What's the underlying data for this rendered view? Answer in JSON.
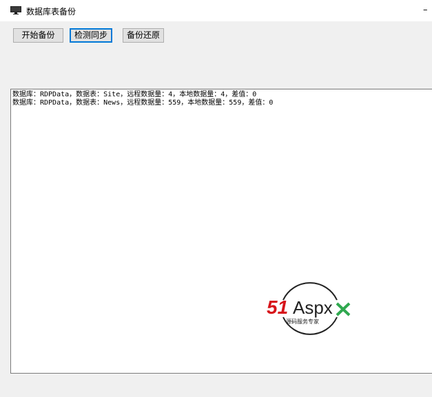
{
  "window": {
    "title": "数据库表备份",
    "minimize_glyph": "–"
  },
  "toolbar": {
    "start_backup": "开始备份",
    "check_sync": "检测同步",
    "restore_backup": "备份还原"
  },
  "log": {
    "lines": [
      "数据库：RDPData，数据表：Site，远程数据量：4，本地数据量：4，差值：0",
      "数据库：RDPData，数据表：News，远程数据量：559，本地数据量：559，差值：0"
    ]
  },
  "watermark": {
    "brand_51": "51",
    "brand_aspx": "Aspx",
    "tagline": "源码服务专家"
  },
  "colors": {
    "brand_red": "#d7141a",
    "brand_green": "#2fa84f",
    "focus_blue": "#0078d7"
  }
}
